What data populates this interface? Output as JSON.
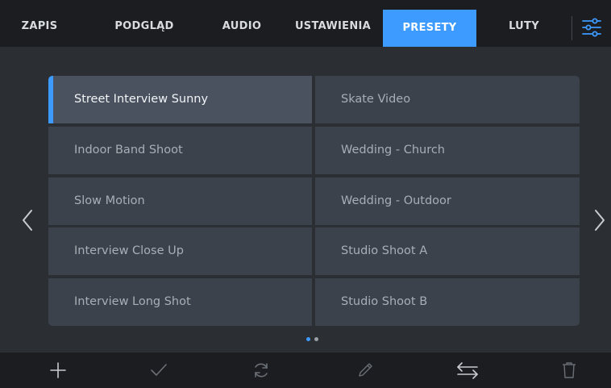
{
  "tabs": [
    {
      "label": "ZAPIS",
      "active": false
    },
    {
      "label": "PODGLĄD",
      "active": false
    },
    {
      "label": "AUDIO",
      "active": false
    },
    {
      "label": "USTAWIENIA",
      "active": false
    },
    {
      "label": "PRESETY",
      "active": true
    },
    {
      "label": "LUTY",
      "active": false
    }
  ],
  "colors": {
    "accent": "#3d9bff",
    "tab_text": "#d9dcdf",
    "tab_active_text": "#ffffff",
    "cell_bg": "#3b424c",
    "cell_selected_bg": "#4a5260",
    "cell_text": "#a9aeb5",
    "cell_selected_text": "#f2f4f6",
    "icon_dim": "#6b7077",
    "icon_light": "#c8cbcf"
  },
  "presets": {
    "left": [
      "Street Interview Sunny",
      "Indoor Band Shoot",
      "Slow Motion",
      "Interview Close Up",
      "Interview Long Shot"
    ],
    "right": [
      "Skate Video",
      "Wedding  - Church",
      "Wedding - Outdoor",
      "Studio Shoot A",
      "Studio Shoot B"
    ],
    "selected": "Street Interview Sunny"
  },
  "pagination": {
    "pages": 2,
    "current": 1
  },
  "icons": {
    "settings": "sliders-icon",
    "prev": "chevron-left-icon",
    "next": "chevron-right-icon",
    "toolbar": [
      "plus-icon",
      "checkmark-icon",
      "refresh-icon",
      "pencil-icon",
      "swap-arrows-icon",
      "trash-icon"
    ]
  }
}
